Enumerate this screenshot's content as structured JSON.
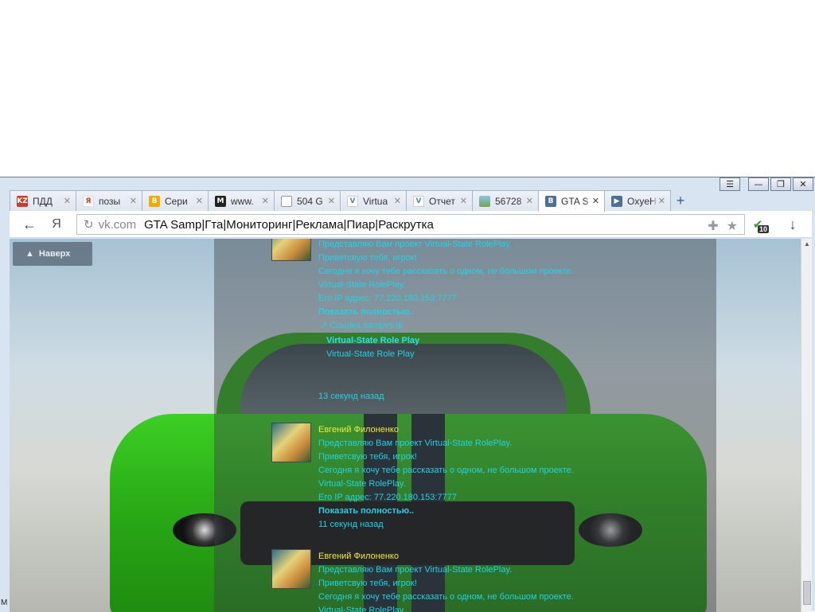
{
  "window": {
    "controls": {
      "menu": "☰",
      "minimize": "—",
      "restore": "❐",
      "close": "✕"
    }
  },
  "tabs": [
    {
      "label": "ПДД",
      "favicon": "KZ",
      "color": "#d23a2b",
      "active": false
    },
    {
      "label": "позы",
      "favicon": "Я",
      "color": "#ffffff",
      "active": false
    },
    {
      "label": "Сери",
      "favicon": "B",
      "color": "#f2a900",
      "active": false
    },
    {
      "label": "www.",
      "favicon": "M",
      "color": "#222222",
      "active": false
    },
    {
      "label": "504 G",
      "favicon": "doc",
      "color": "#ffffff",
      "active": false
    },
    {
      "label": "Virtua",
      "favicon": "V",
      "color": "#5b83b8",
      "active": false
    },
    {
      "label": "Отчет",
      "favicon": "V",
      "color": "#5b83b8",
      "active": false
    },
    {
      "label": "56728",
      "favicon": "img",
      "color": "#6aa84f",
      "active": false
    },
    {
      "label": "GTA S",
      "favicon": "B",
      "color": "#4c6f9a",
      "active": true
    },
    {
      "label": "OxyeH",
      "favicon": "▶",
      "color": "#4c6f9a",
      "active": false
    }
  ],
  "toolbar": {
    "back": "←",
    "yandex": "Я",
    "reload": "↻",
    "host": "vk.com",
    "page_title": "GTA Samp|Гта|Мониторинг|Реклама|Пиар|Раскрутка",
    "extension_badge": "10",
    "download": "↓"
  },
  "page": {
    "up_button": "Наверх",
    "posts": [
      {
        "author": "",
        "lines": [
          "Представляю Вам проект Virtual-State RolePlay.",
          "Приветсвую тебя, игрок!",
          "Сегодня я хочу тебе рассказать о одном, не большом проекте.",
          "Virtual-State RolePlay.",
          "Его IP адрес: 77.220.180.153:7777"
        ],
        "show_more": "Показать полностью..",
        "link": "Ссылка sampvs.tk",
        "snippet_title": "Virtual-State Role Play",
        "snippet_sub": "Virtual-State Role Play",
        "time": "13 секунд назад"
      },
      {
        "author": "Евгений Филоненко",
        "lines": [
          "Представляю Вам проект Virtual-State RolePlay.",
          "Приветсвую тебя, игрок!",
          "Сегодня я хочу тебе рассказать о одном, не большом проекте.",
          "Virtual-State RolePlay.",
          "Его IP адрес: 77.220.180.153:7777"
        ],
        "show_more": "Показать полностью..",
        "time": "11 секунд назад"
      },
      {
        "author": "Евгений Филоненко",
        "lines": [
          "Представляю Вам проект Virtual-State RolePlay.",
          "Приветсвую тебя, игрок!",
          "Сегодня я хочу тебе рассказать о одном, не большом проекте.",
          "Virtual-State RolePlay."
        ]
      }
    ]
  },
  "corner_text": "M"
}
